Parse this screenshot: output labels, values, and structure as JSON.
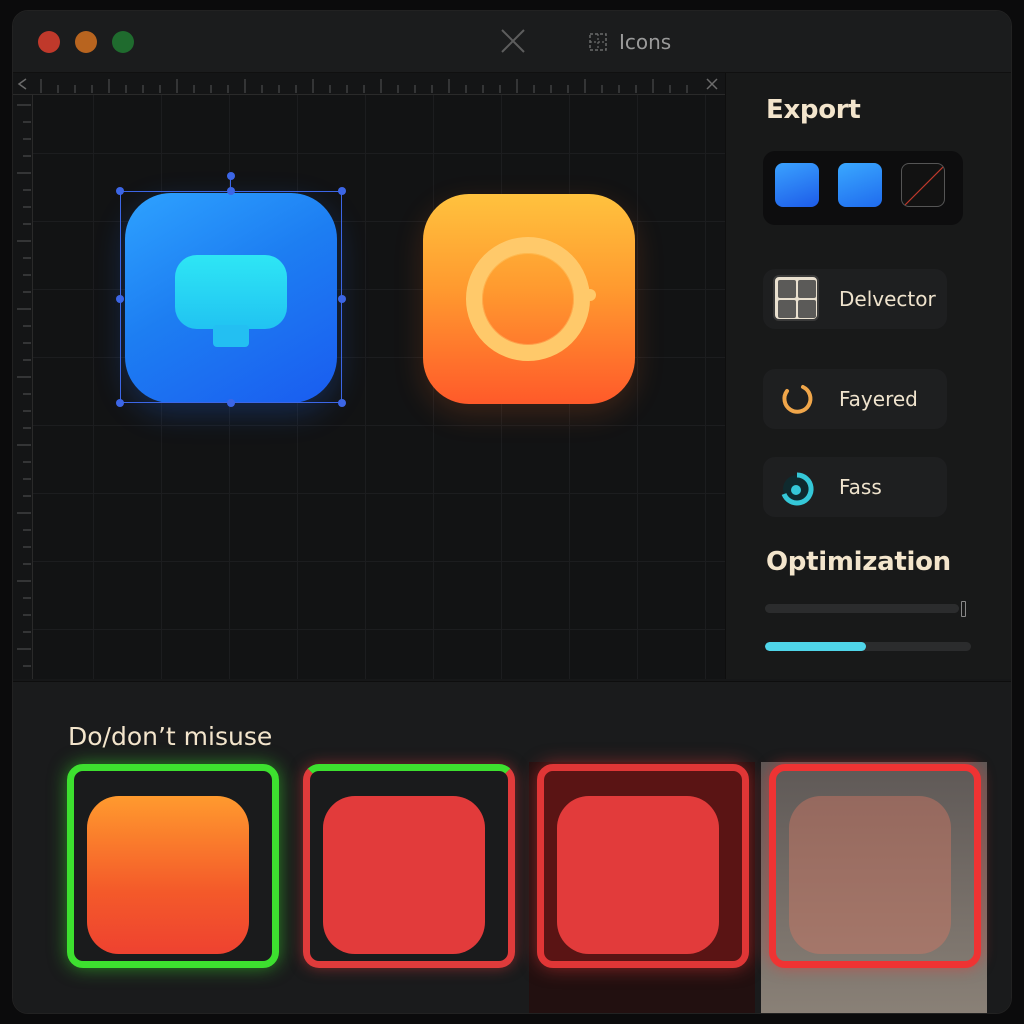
{
  "window": {
    "title": "Icons"
  },
  "canvas": {
    "icons": [
      {
        "name": "chat-app-icon",
        "selected": true
      },
      {
        "name": "ring-app-icon",
        "selected": false
      }
    ]
  },
  "panel": {
    "export_title": "Export",
    "swatches": [
      "#2f8cf8",
      "#2a86f6",
      "none"
    ],
    "options": [
      {
        "label": "Delvector",
        "icon": "grid-icon"
      },
      {
        "label": "Fayered",
        "icon": "ring-icon"
      },
      {
        "label": "Fass",
        "icon": "donut-icon"
      }
    ],
    "optimization_title": "Optimization",
    "sliders": [
      {
        "name": "optimization-slider-1",
        "value": 1.0
      },
      {
        "name": "optimization-slider-2",
        "value": 0.49
      }
    ]
  },
  "bottom": {
    "title": "Do/don’t misuse",
    "examples": [
      {
        "status": "do",
        "color": "#3de02f"
      },
      {
        "status": "mixed",
        "color": "#e03b3b"
      },
      {
        "status": "dont",
        "color": "#e03636"
      },
      {
        "status": "dont",
        "color": "#ef3333"
      }
    ]
  },
  "colors": {
    "accent_blue": "#1d7ef2",
    "accent_orange": "#ff9a2f",
    "accent_cyan": "#4fd5e9",
    "good_green": "#3de02f",
    "bad_red": "#e03636"
  }
}
